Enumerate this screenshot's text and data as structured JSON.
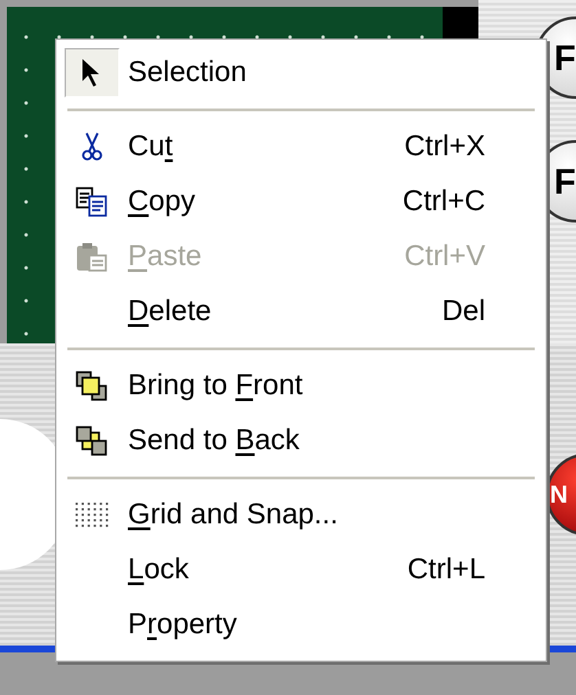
{
  "canvas": {
    "buttons": [
      {
        "label": "F"
      },
      {
        "label": "F"
      },
      {
        "label": "N"
      }
    ]
  },
  "context_menu": {
    "items": [
      {
        "kind": "item",
        "text_before": "Selection",
        "checked": true,
        "disabled": false
      },
      {
        "kind": "separator"
      },
      {
        "kind": "item",
        "text_before": "Cu",
        "mnemonic": "t",
        "shortcut": "Ctrl+X",
        "checked": false,
        "disabled": false
      },
      {
        "kind": "item",
        "mnemonic": "C",
        "text_after": "opy",
        "shortcut": "Ctrl+C",
        "checked": false,
        "disabled": false
      },
      {
        "kind": "item",
        "mnemonic": "P",
        "text_after": "aste",
        "shortcut": "Ctrl+V",
        "checked": false,
        "disabled": true
      },
      {
        "kind": "item",
        "mnemonic": "D",
        "text_after": "elete",
        "shortcut": "Del",
        "checked": false,
        "disabled": false
      },
      {
        "kind": "separator"
      },
      {
        "kind": "item",
        "text_before": "Bring to ",
        "mnemonic": "F",
        "text_after": "ront",
        "checked": false,
        "disabled": false
      },
      {
        "kind": "item",
        "text_before": "Send to ",
        "mnemonic": "B",
        "text_after": "ack",
        "checked": false,
        "disabled": false
      },
      {
        "kind": "separator"
      },
      {
        "kind": "item",
        "mnemonic": "G",
        "text_after": "rid and Snap...",
        "checked": false,
        "disabled": false
      },
      {
        "kind": "item",
        "mnemonic": "L",
        "text_after": "ock",
        "shortcut": "Ctrl+L",
        "checked": false,
        "disabled": false
      },
      {
        "kind": "item",
        "text_before": "P",
        "mnemonic": "r",
        "text_after": "operty",
        "checked": false,
        "disabled": false
      }
    ]
  }
}
